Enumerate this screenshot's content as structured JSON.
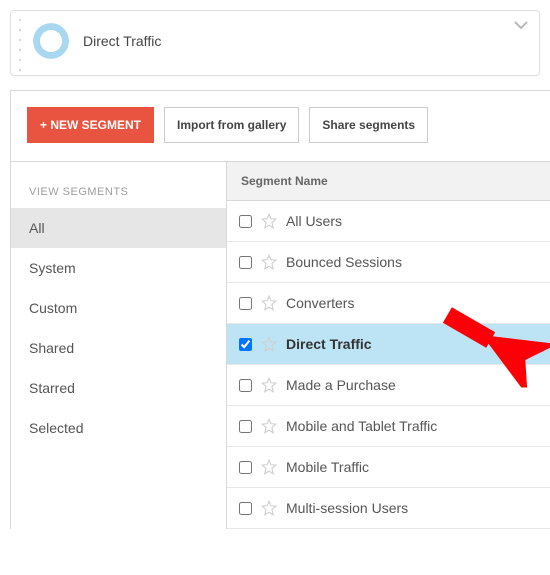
{
  "summary": {
    "title": "Direct Traffic"
  },
  "toolbar": {
    "new_segment": "NEW SEGMENT",
    "import": "Import from gallery",
    "share": "Share segments"
  },
  "sidebar": {
    "header": "VIEW SEGMENTS",
    "items": [
      {
        "label": "All",
        "active": true
      },
      {
        "label": "System",
        "active": false
      },
      {
        "label": "Custom",
        "active": false
      },
      {
        "label": "Shared",
        "active": false
      },
      {
        "label": "Starred",
        "active": false
      },
      {
        "label": "Selected",
        "active": false
      }
    ]
  },
  "segments": {
    "column_header": "Segment Name",
    "rows": [
      {
        "label": "All Users",
        "checked": false,
        "highlight": false
      },
      {
        "label": "Bounced Sessions",
        "checked": false,
        "highlight": false
      },
      {
        "label": "Converters",
        "checked": false,
        "highlight": false
      },
      {
        "label": "Direct Traffic",
        "checked": true,
        "highlight": true
      },
      {
        "label": "Made a Purchase",
        "checked": false,
        "highlight": false
      },
      {
        "label": "Mobile and Tablet Traffic",
        "checked": false,
        "highlight": false
      },
      {
        "label": "Mobile Traffic",
        "checked": false,
        "highlight": false
      },
      {
        "label": "Multi-session Users",
        "checked": false,
        "highlight": false
      }
    ]
  }
}
